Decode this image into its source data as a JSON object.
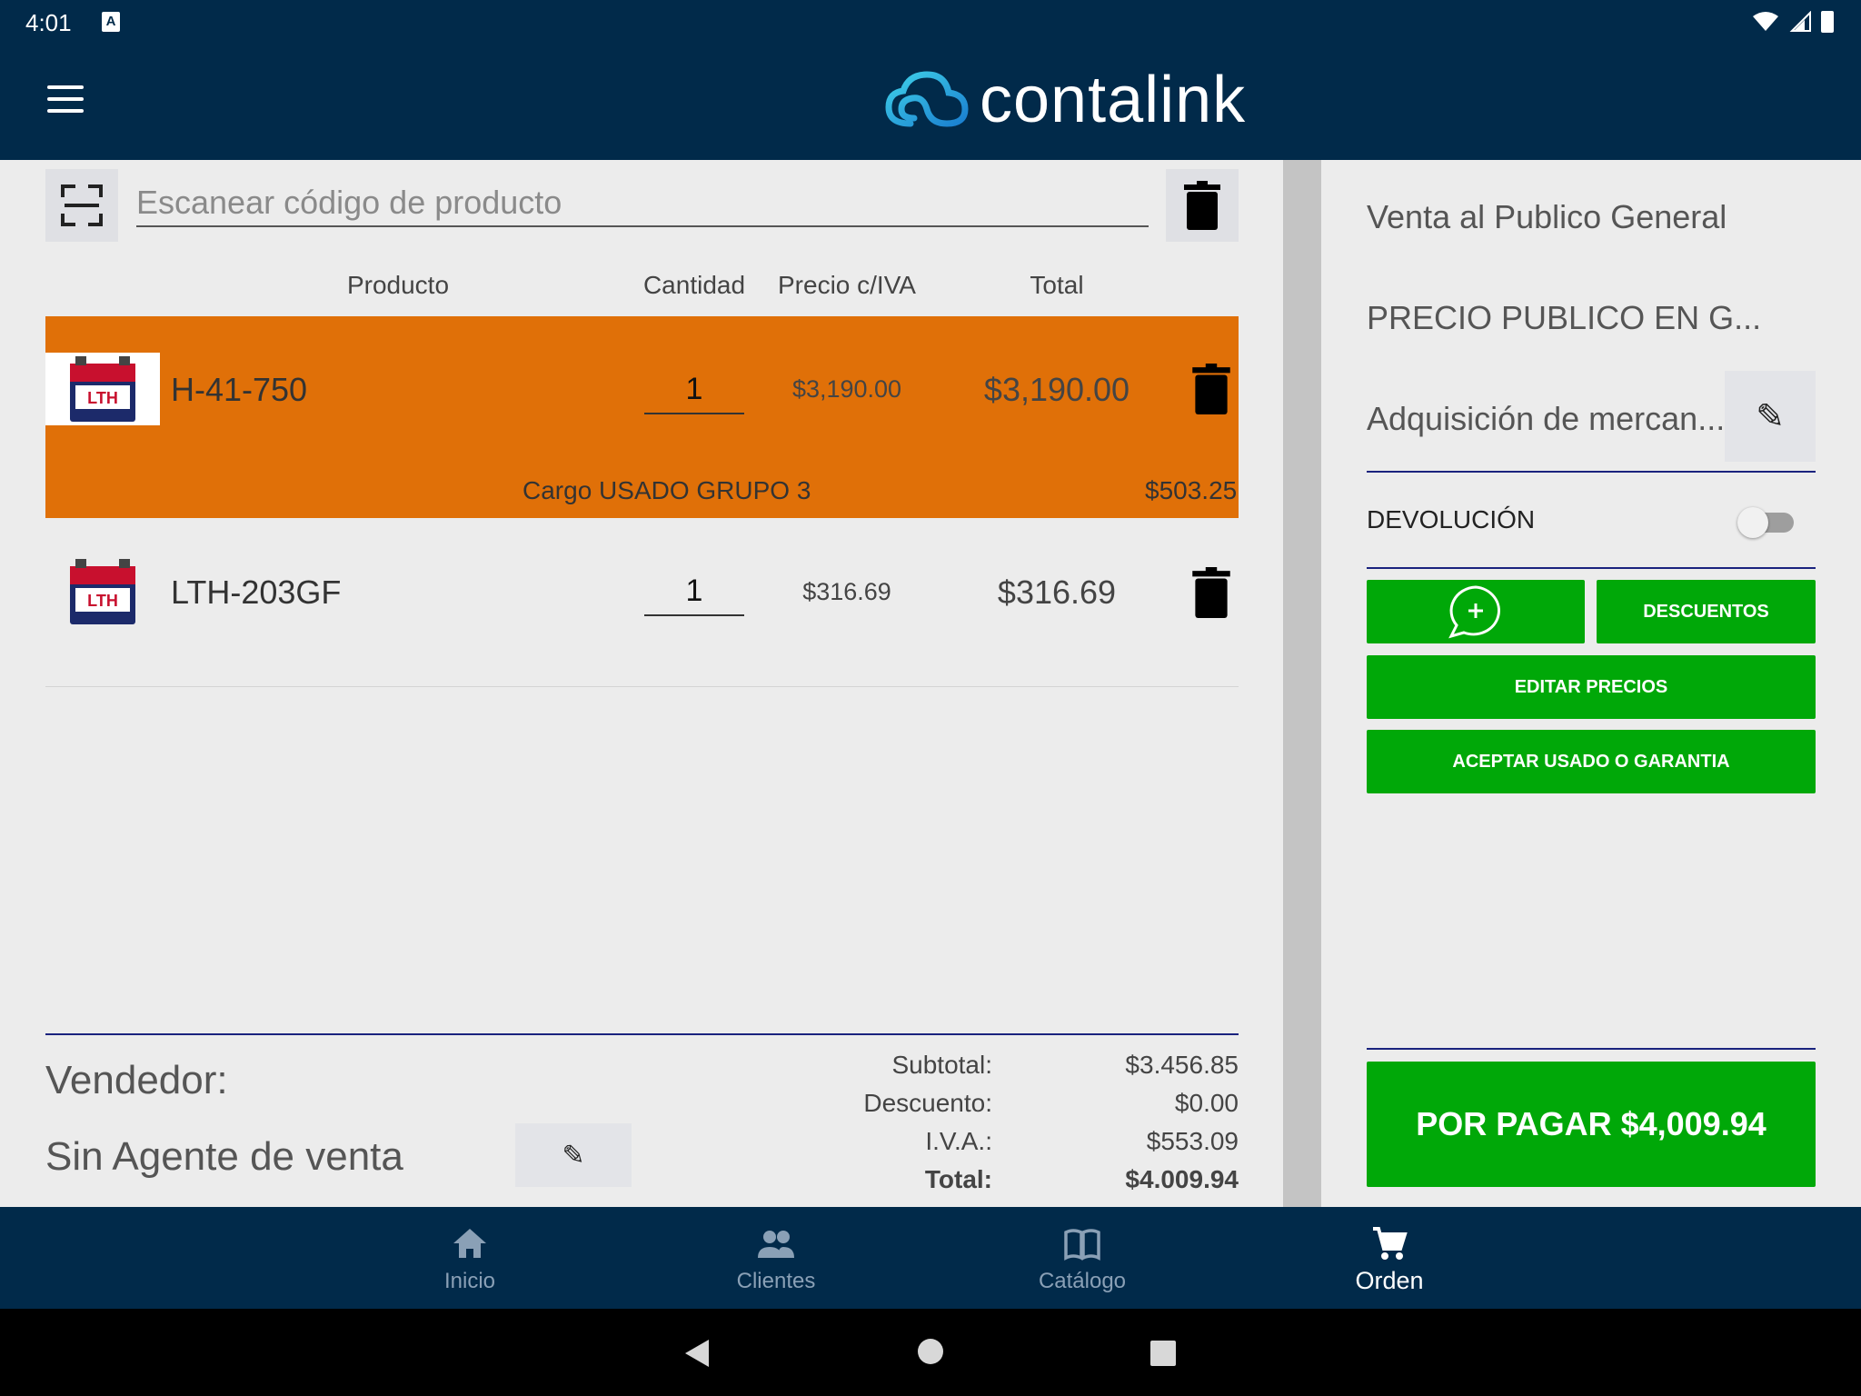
{
  "status": {
    "time": "4:01",
    "a_icon": "A"
  },
  "header": {
    "menu_icon": "menu-icon",
    "logo_text": "contalink"
  },
  "scan": {
    "placeholder": "Escanear código de producto"
  },
  "columns": {
    "product": "Producto",
    "quantity": "Cantidad",
    "price": "Precio c/IVA",
    "total": "Total"
  },
  "items": [
    {
      "code": "H-41-750",
      "quantity": "1",
      "price": "$3,190.00",
      "total": "$3,190.00",
      "selected": true,
      "charge_label": "Cargo USADO GRUPO 3",
      "charge_value": "$503.25",
      "image_text": "LTH"
    },
    {
      "code": "LTH-203GF",
      "quantity": "1",
      "price": "$316.69",
      "total": "$316.69",
      "selected": false,
      "image_text": "LTH"
    }
  ],
  "seller": {
    "label": "Vendedor:",
    "name": "Sin Agente de venta",
    "edit_icon": "✎"
  },
  "summary": {
    "subtotal_label": "Subtotal:",
    "subtotal": "$3.456.85",
    "discount_label": "Descuento:",
    "discount": "$0.00",
    "iva_label": "I.V.A.:",
    "iva": "$553.09",
    "total_label": "Total:",
    "total": "$4.009.94"
  },
  "right": {
    "client": "Venta al Publico General",
    "price_list": "PRECIO PUBLICO EN G...",
    "concept": "Adquisición de mercan...",
    "edit_icon": "✎",
    "return_label": "DEVOLUCIÓN",
    "return_enabled": false,
    "discounts_label": "DESCUENTOS",
    "edit_prices_label": "EDITAR PRECIOS",
    "accept_used_label": "ACEPTAR USADO O GARANTIA",
    "pay_label": "POR PAGAR $4,009.94"
  },
  "nav": [
    {
      "label": "Inicio",
      "icon": "home-icon",
      "active": false
    },
    {
      "label": "Clientes",
      "icon": "people-icon",
      "active": false
    },
    {
      "label": "Catálogo",
      "icon": "book-icon",
      "active": false
    },
    {
      "label": "Orden",
      "icon": "cart-icon",
      "active": true
    }
  ],
  "colors": {
    "primary": "#012a4a",
    "accent_orange": "#e07008",
    "green": "#00a808",
    "divider": "#1a237e"
  }
}
